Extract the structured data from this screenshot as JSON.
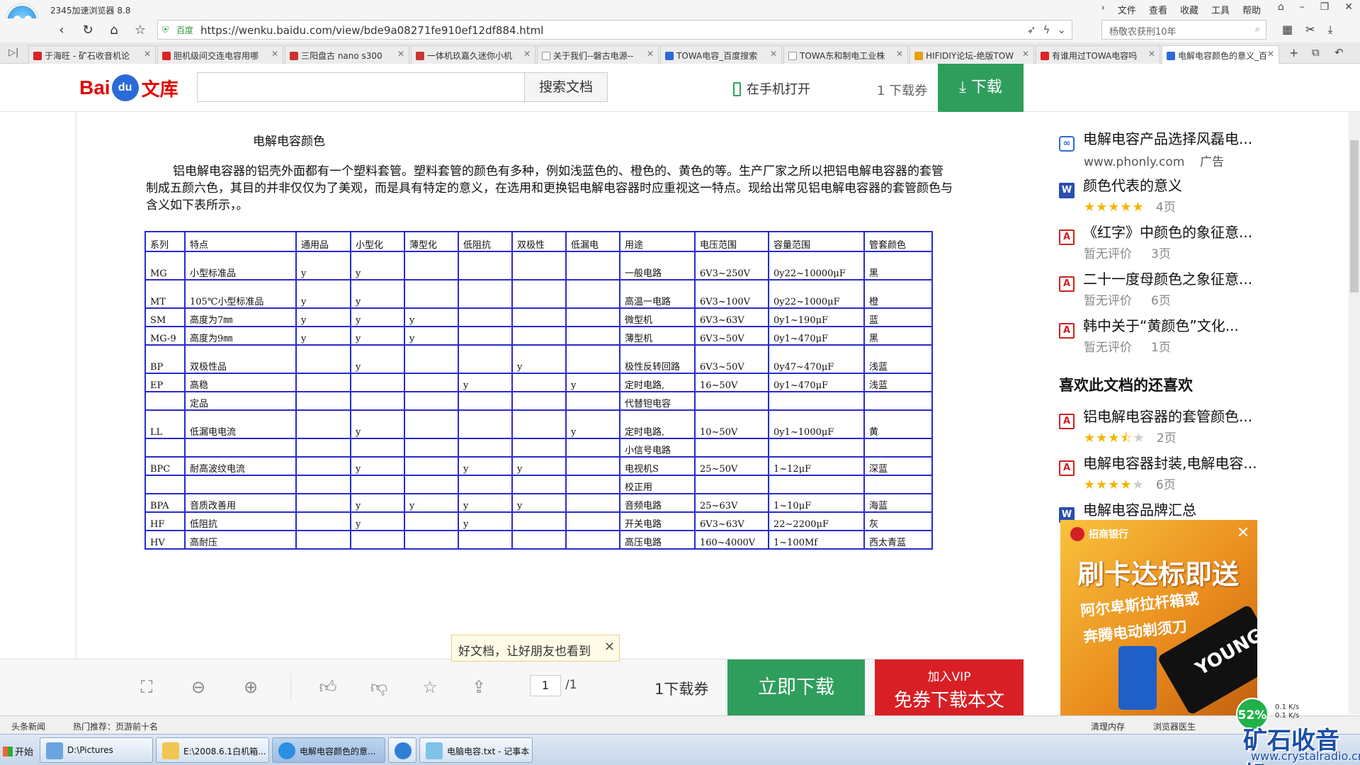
{
  "browser": {
    "title": "2345加速浏览器 8.8",
    "menu": [
      "文件",
      "查看",
      "收藏",
      "工具",
      "帮助"
    ],
    "url_site": "百度",
    "url": "https://wenku.baidu.com/view/bde9a08271fe910ef12df884.html",
    "search_text": "杨敬农获刑10年",
    "tabs": [
      "于海旺 - 矿石收音机论",
      "胆机级间交连电容用哪",
      "三阳盘古 nano s300",
      "一体机玖嘉久迷你小机",
      "关于我们--磐古电源--",
      "TOWA电容_百度搜索",
      "TOWA东和制电工业株",
      "HIFIDIY论坛-绝版TOW",
      "有谁用过TOWA电容吗",
      "电解电容颜色的意义_百"
    ]
  },
  "wenku": {
    "search_button": "搜索文档",
    "phone_open": "在手机打开",
    "download_count": "1 下载券",
    "download": "下载"
  },
  "doc": {
    "title": "电解电容颜色",
    "paragraph": "铝电解电容器的铝壳外面都有一个塑料套管。塑料套管的颜色有多种，例如浅蓝色的、橙色的、黄色的等。生产厂家之所以把铝电解电容器的套管制成五颜六色，其目的并非仅仅为了美观，而是具有特定的意义，在选用和更换铝电解电容器时应重视这一特点。现给出常见铝电解电容器的套管颜色与含义如下表所示，。",
    "table": {
      "headers": [
        "系列",
        "特点",
        "通用品",
        "小型化",
        "薄型化",
        "低阻抗",
        "双极性",
        "低漏电",
        "用途",
        "电压范围",
        "容量范围",
        "管套颜色"
      ],
      "rows": [
        [
          "MG",
          "小型标准品",
          "y",
          "y",
          "",
          "",
          "",
          "",
          "一般电路",
          "6V3~250V",
          "0y22~10000μF",
          "黑"
        ],
        [
          "MT",
          "105℃小型标准品",
          "y",
          "y",
          "",
          "",
          "",
          "",
          "高温一电路",
          "6V3~100V",
          "0y22~1000μF",
          "橙"
        ],
        [
          "SM",
          "高度为7㎜",
          "y",
          "y",
          "y",
          "",
          "",
          "",
          "微型机",
          "6V3~63V",
          "0y1~190μF",
          "蓝"
        ],
        [
          "MG-9",
          "高度为9㎜",
          "y",
          "y",
          "y",
          "",
          "",
          "",
          "薄型机",
          "6V3~50V",
          "0y1~470μF",
          "黑"
        ],
        [
          "BP",
          "双极性品",
          "",
          "y",
          "",
          "",
          "y",
          "",
          "极性反转回路",
          "6V3~50V",
          "0y47~470μF",
          "浅蓝"
        ],
        [
          "EP",
          "高稳",
          "",
          "",
          "",
          "y",
          "",
          "y",
          "定时电路,",
          "16~50V",
          "0y1~470μF",
          "浅蓝"
        ],
        [
          "",
          "定品",
          "",
          "",
          "",
          "",
          "",
          "",
          "代替钽电容",
          "",
          "",
          ""
        ],
        [
          "LL",
          "低漏电电流",
          "",
          "y",
          "",
          "",
          "",
          "y",
          "定时电路,",
          "10~50V",
          "0y1~1000μF",
          "黄"
        ],
        [
          "",
          "",
          "",
          "",
          "",
          "",
          "",
          "",
          "小信号电路",
          "",
          "",
          ""
        ],
        [
          "BPC",
          "耐高波纹电流",
          "",
          "y",
          "",
          "y",
          "y",
          "",
          "电视机S",
          "25~50V",
          "1~12μF",
          "深蓝"
        ],
        [
          "",
          "",
          "",
          "",
          "",
          "",
          "",
          "",
          "校正用",
          "",
          "",
          ""
        ],
        [
          "BPA",
          "音质改善用",
          "",
          "y",
          "y",
          "y",
          "y",
          "",
          "音频电路",
          "25~63V",
          "1~10μF",
          "海蓝"
        ],
        [
          "HF",
          "低阻抗",
          "",
          "y",
          "",
          "y",
          "",
          "",
          "开关电路",
          "6V3~63V",
          "22~2200μF",
          "灰"
        ],
        [
          "HV",
          "高耐压",
          "",
          "",
          "",
          "",
          "",
          "",
          "高压电路",
          "160~4000V",
          "1~100Mf",
          "西太青蓝"
        ]
      ]
    }
  },
  "right_panel": {
    "items": [
      {
        "title": "电解电容产品选择风磊电...",
        "sub": "www.phonly.com",
        "ad": "广告",
        "icon": "link-icon"
      },
      {
        "title": "颜色代表的意义",
        "stars": 5,
        "pages": "4页",
        "icon": "word-icon"
      },
      {
        "title": "《红字》中颜色的象征意...",
        "rating": "暂无评价",
        "pages": "3页",
        "icon": "pdf-icon"
      },
      {
        "title": "二十一度母颜色之象征意...",
        "rating": "暂无评价",
        "pages": "6页",
        "icon": "pdf-icon"
      },
      {
        "title": "韩中关于“黄颜色”文化...",
        "rating": "暂无评价",
        "pages": "1页",
        "icon": "pdf-icon"
      }
    ],
    "heading": "喜欢此文档的还喜欢",
    "liked": [
      {
        "title": "铝电解电容器的套管颜色...",
        "stars": 3.5,
        "pages": "2页",
        "icon": "pdf-icon"
      },
      {
        "title": "电解电容器封装,电解电容...",
        "stars": 4,
        "pages": "6页",
        "icon": "pdf-icon"
      },
      {
        "title": "电解电容品牌汇总",
        "icon": "word-icon"
      }
    ],
    "ad": {
      "bank": "招商银行",
      "line1": "刷卡达标即送",
      "line2": "阿尔卑斯拉杆箱或",
      "line3": "奔腾电动剃须刀",
      "card_text": "YOUNG"
    }
  },
  "bottom_bar": {
    "page_current": "1",
    "page_total": "/1",
    "download_count": "1下载券",
    "download_now": "立即下载",
    "vip_line1": "加入VIP",
    "vip_line2": "免券下载本文",
    "tooltip": "好文档，让好朋友也看到"
  },
  "status_bar": {
    "news": "头条新闻",
    "hot": "热门推荐：页游前十名",
    "clean": "清理内存",
    "doctor": "浏览器医生",
    "net_percent": "52%",
    "net_up": "0.1 K/s",
    "net_down": "0.1 K/s"
  },
  "taskbar": {
    "start": "开始",
    "items": [
      "D:\\Pictures",
      "E:\\2008.6.1白机箱...",
      "电解电容颜色的意...",
      "",
      "电脑电容.txt - 记事本"
    ]
  },
  "watermark": {
    "text": "矿石收音机",
    "url": "www.crystalradio.cn"
  }
}
